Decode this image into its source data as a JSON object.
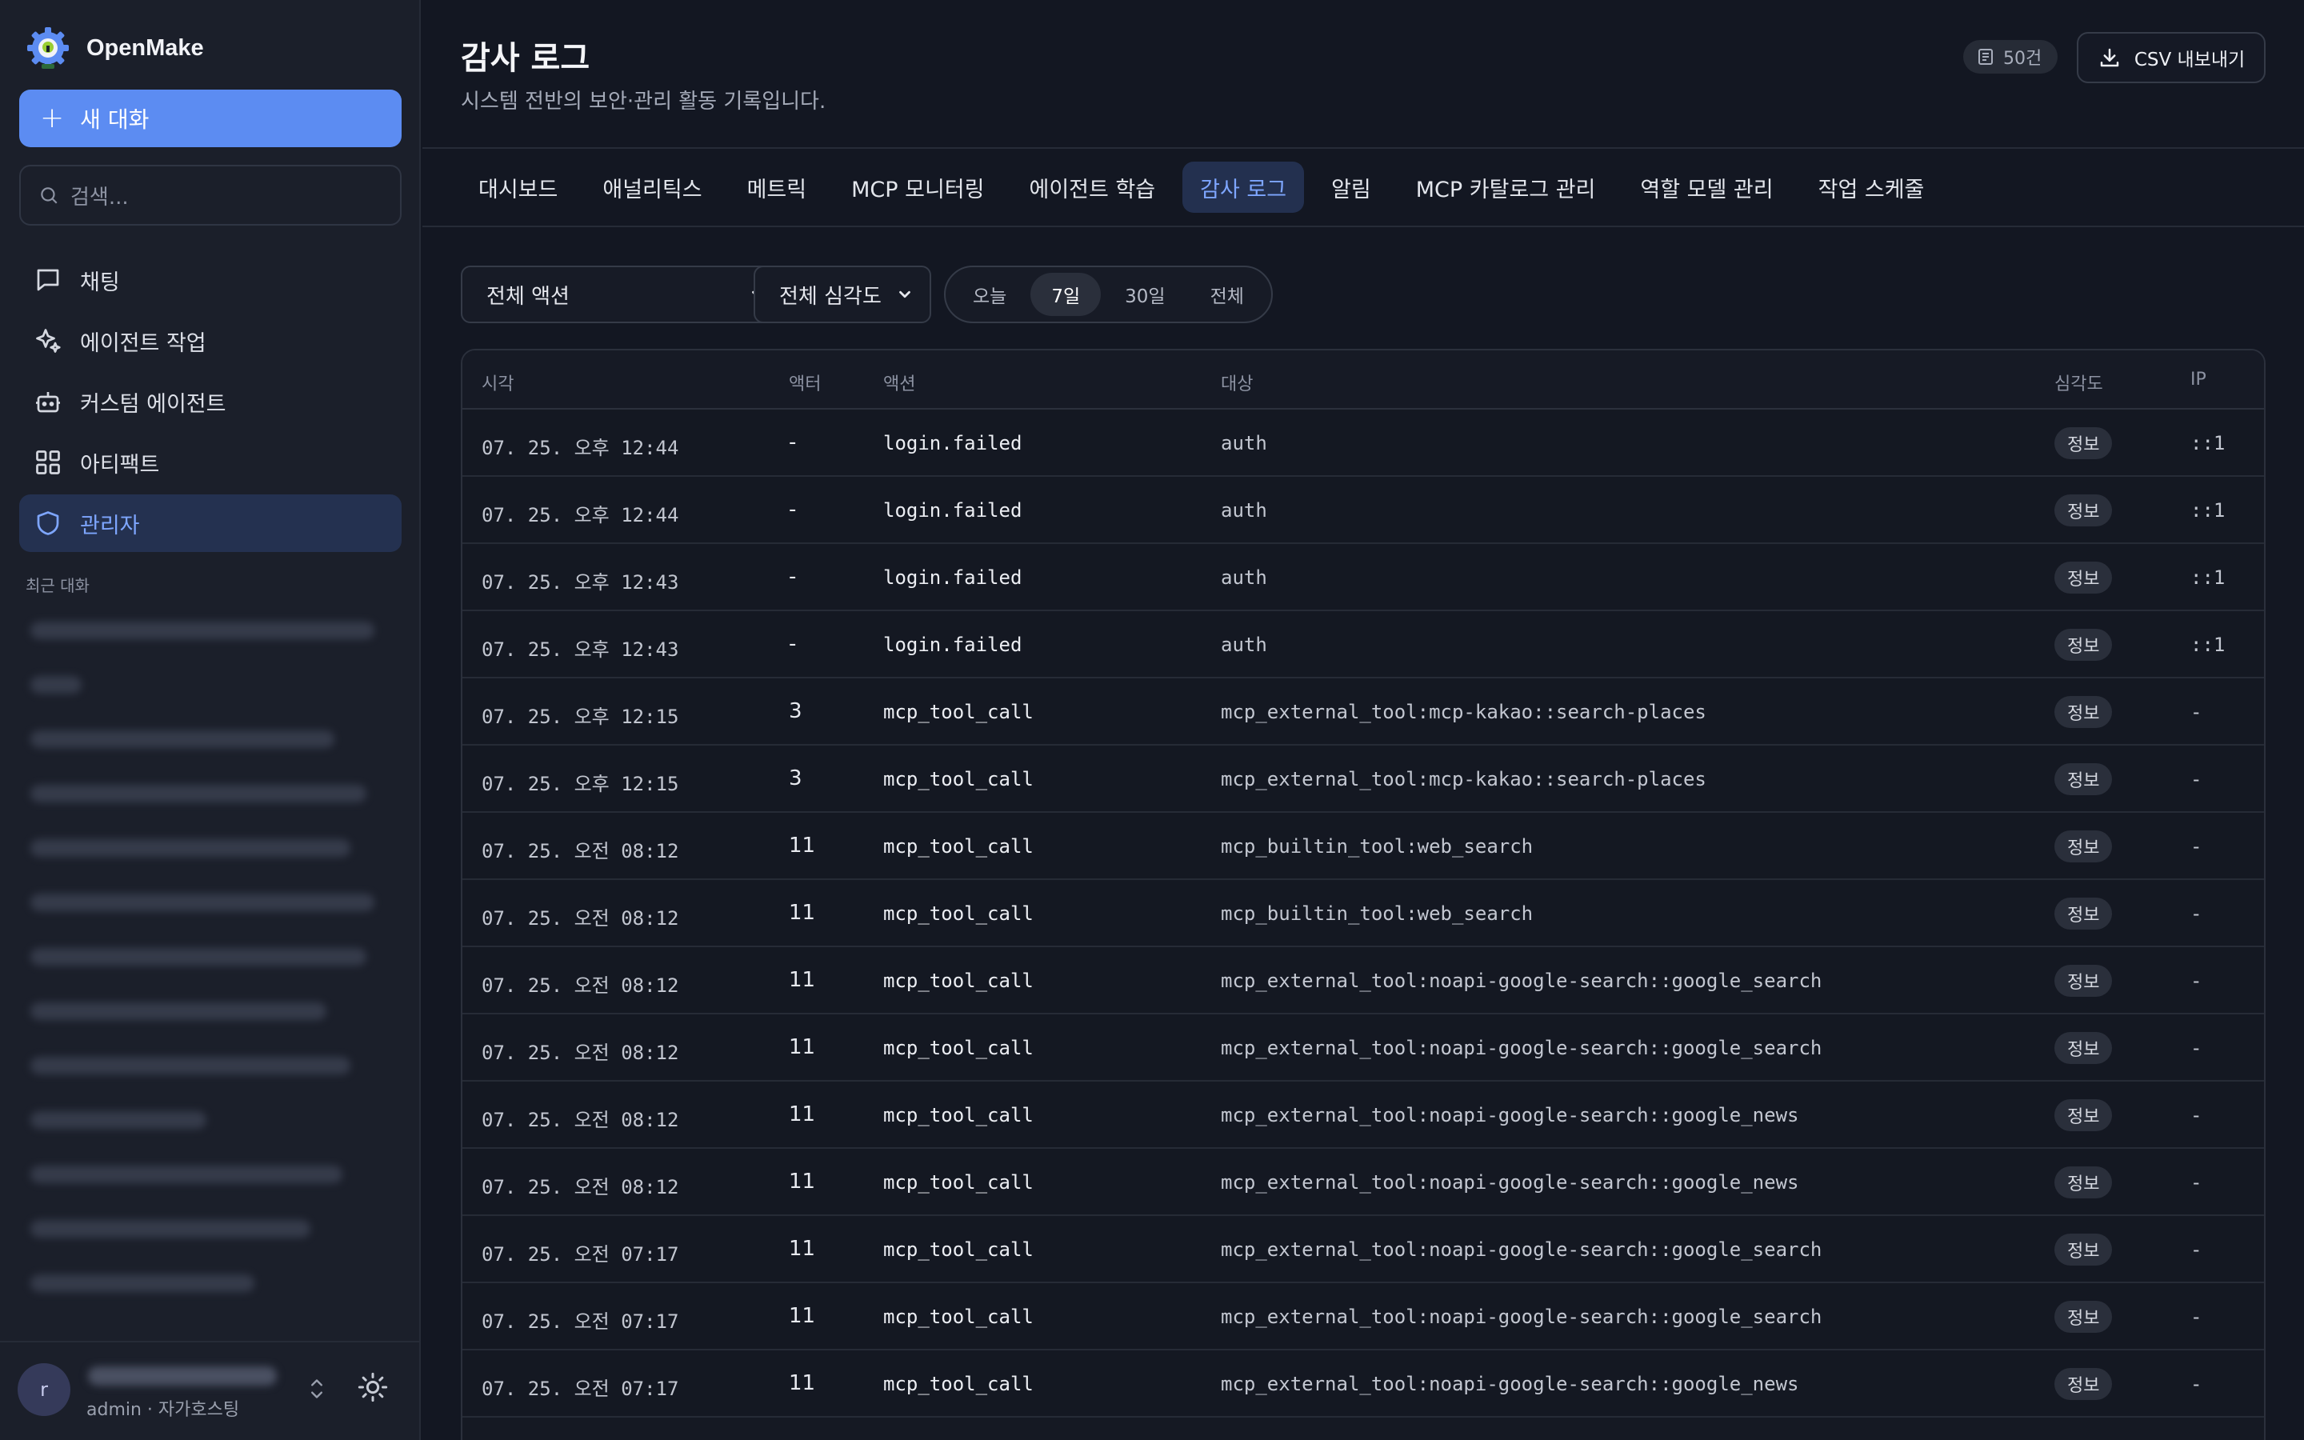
{
  "sidebar": {
    "brand": "OpenMake",
    "new_chat": "새 대화",
    "search_placeholder": "검색...",
    "nav": [
      {
        "label": "채팅",
        "icon": "chat-bubble-icon"
      },
      {
        "label": "에이전트 작업",
        "icon": "sparkles-icon"
      },
      {
        "label": "커스텀 에이전트",
        "icon": "robot-icon"
      },
      {
        "label": "아티팩트",
        "icon": "grid-icon"
      },
      {
        "label": "관리자",
        "icon": "shield-icon",
        "active": true
      }
    ],
    "recent_label": "최근 대화",
    "user": {
      "avatar_initial": "r",
      "role": "admin · 자가호스팅"
    }
  },
  "header": {
    "title": "감사 로그",
    "subtitle": "시스템 전반의 보안·관리 활동 기록입니다.",
    "count": "50건",
    "export_label": "CSV 내보내기"
  },
  "tabs": [
    {
      "label": "대시보드"
    },
    {
      "label": "애널리틱스"
    },
    {
      "label": "메트릭"
    },
    {
      "label": "MCP 모니터링"
    },
    {
      "label": "에이전트 학습"
    },
    {
      "label": "감사 로그",
      "active": true
    },
    {
      "label": "알림"
    },
    {
      "label": "MCP 카탈로그 관리"
    },
    {
      "label": "역할 모델 관리"
    },
    {
      "label": "작업 스케줄"
    }
  ],
  "filters": {
    "action": "전체 액션",
    "severity": "전체 심각도",
    "ranges": [
      "오늘",
      "7일",
      "30일",
      "전체"
    ],
    "active_range": "7일"
  },
  "table": {
    "columns": {
      "time": "시각",
      "actor": "액터",
      "action": "액션",
      "target": "대상",
      "severity": "심각도",
      "ip": "IP"
    },
    "rows": [
      {
        "time": "07. 25. 오후 12:44",
        "actor": "-",
        "action": "login.failed",
        "target": "auth",
        "severity": "정보",
        "ip": "::1"
      },
      {
        "time": "07. 25. 오후 12:44",
        "actor": "-",
        "action": "login.failed",
        "target": "auth",
        "severity": "정보",
        "ip": "::1"
      },
      {
        "time": "07. 25. 오후 12:43",
        "actor": "-",
        "action": "login.failed",
        "target": "auth",
        "severity": "정보",
        "ip": "::1"
      },
      {
        "time": "07. 25. 오후 12:43",
        "actor": "-",
        "action": "login.failed",
        "target": "auth",
        "severity": "정보",
        "ip": "::1"
      },
      {
        "time": "07. 25. 오후 12:15",
        "actor": "3",
        "action": "mcp_tool_call",
        "target": "mcp_external_tool:mcp-kakao::search-places",
        "severity": "정보",
        "ip": "-"
      },
      {
        "time": "07. 25. 오후 12:15",
        "actor": "3",
        "action": "mcp_tool_call",
        "target": "mcp_external_tool:mcp-kakao::search-places",
        "severity": "정보",
        "ip": "-"
      },
      {
        "time": "07. 25. 오전 08:12",
        "actor": "11",
        "action": "mcp_tool_call",
        "target": "mcp_builtin_tool:web_search",
        "severity": "정보",
        "ip": "-"
      },
      {
        "time": "07. 25. 오전 08:12",
        "actor": "11",
        "action": "mcp_tool_call",
        "target": "mcp_builtin_tool:web_search",
        "severity": "정보",
        "ip": "-"
      },
      {
        "time": "07. 25. 오전 08:12",
        "actor": "11",
        "action": "mcp_tool_call",
        "target": "mcp_external_tool:noapi-google-search::google_search",
        "severity": "정보",
        "ip": "-"
      },
      {
        "time": "07. 25. 오전 08:12",
        "actor": "11",
        "action": "mcp_tool_call",
        "target": "mcp_external_tool:noapi-google-search::google_search",
        "severity": "정보",
        "ip": "-"
      },
      {
        "time": "07. 25. 오전 08:12",
        "actor": "11",
        "action": "mcp_tool_call",
        "target": "mcp_external_tool:noapi-google-search::google_news",
        "severity": "정보",
        "ip": "-"
      },
      {
        "time": "07. 25. 오전 08:12",
        "actor": "11",
        "action": "mcp_tool_call",
        "target": "mcp_external_tool:noapi-google-search::google_news",
        "severity": "정보",
        "ip": "-"
      },
      {
        "time": "07. 25. 오전 07:17",
        "actor": "11",
        "action": "mcp_tool_call",
        "target": "mcp_external_tool:noapi-google-search::google_search",
        "severity": "정보",
        "ip": "-"
      },
      {
        "time": "07. 25. 오전 07:17",
        "actor": "11",
        "action": "mcp_tool_call",
        "target": "mcp_external_tool:noapi-google-search::google_search",
        "severity": "정보",
        "ip": "-"
      },
      {
        "time": "07. 25. 오전 07:17",
        "actor": "11",
        "action": "mcp_tool_call",
        "target": "mcp_external_tool:noapi-google-search::google_news",
        "severity": "정보",
        "ip": "-"
      }
    ]
  },
  "colors": {
    "accent": "#5c8cf2",
    "active_text": "#7ea6ff",
    "background": "#131722"
  }
}
